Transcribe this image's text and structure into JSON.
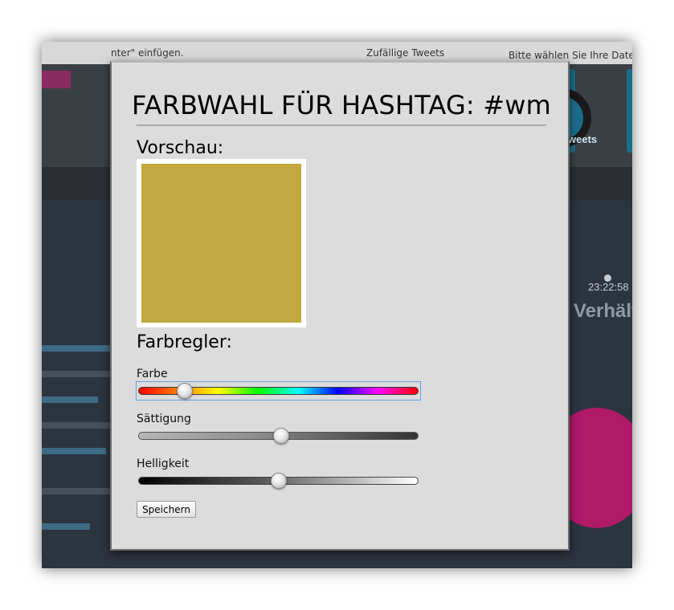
{
  "background": {
    "top_text_left": "nter\" einfügen.",
    "top_text_mid": "Zufällige Tweets",
    "top_text_right": "Bitte wählen Sie Ihre Date",
    "tile_label": "weets",
    "timestamp": "23:22:58",
    "big_text": "Verhält"
  },
  "dialog": {
    "title": "FARBWAHL FÜR HASHTAG: #wm",
    "preview_heading": "Vorschau:",
    "preview_color": "#c0aa3f",
    "sliders_heading": "Farbregler:",
    "sliders": [
      {
        "label": "Farbe",
        "value_fraction": 0.15
      },
      {
        "label": "Sättigung",
        "value_fraction": 0.51
      },
      {
        "label": "Helligkeit",
        "value_fraction": 0.5
      }
    ],
    "save_label": "Speichern"
  }
}
